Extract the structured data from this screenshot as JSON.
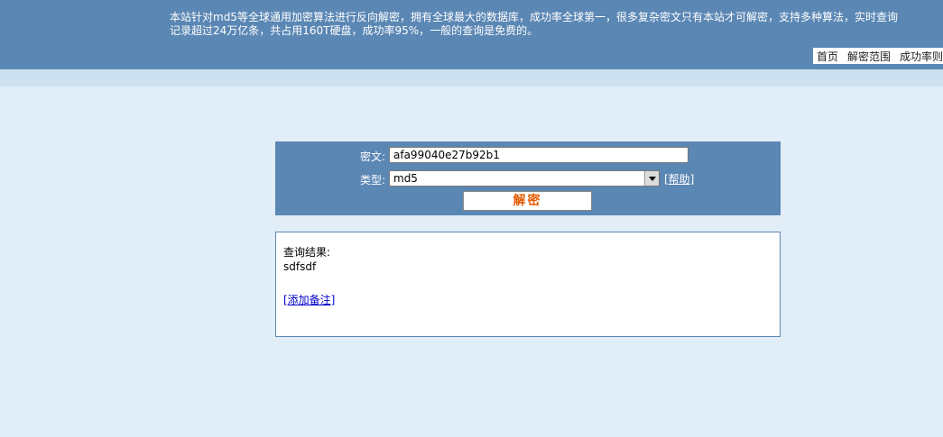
{
  "header": {
    "intro": "本站针对md5等全球通用加密算法进行反向解密，拥有全球最大的数据库，成功率全球第一，很多复杂密文只有本站才可解密，支持多种算法，实时查询记录超过24万亿条，共占用160T硬盘，成功率95%，一般的查询是免费的。",
    "nav": [
      "首页",
      "解密范围",
      "成功率则"
    ]
  },
  "form": {
    "cipher_label": "密文:",
    "cipher_value": "afa99040e27b92b1",
    "type_label": "类型:",
    "type_value": "md5",
    "help_label": "[帮助]",
    "decrypt_label": "解密"
  },
  "result": {
    "label": "查询结果:",
    "value": "sdfsdf",
    "add_note_label": "[添加备注]"
  },
  "icons": {
    "dropdown": "chevron-down-icon"
  },
  "colors": {
    "header_bg": "#5b87b4",
    "page_bg": "#e1edf7",
    "band_bg": "#cce0ef",
    "button_text": "#e45a00",
    "link": "#0000cc"
  }
}
